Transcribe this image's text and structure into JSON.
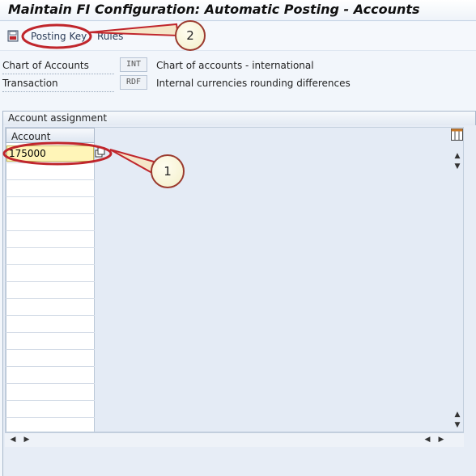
{
  "window": {
    "title": "Maintain FI Configuration: Automatic Posting - Accounts"
  },
  "toolbar": {
    "posting_key_label": "Posting Key",
    "rules_label": "Rules"
  },
  "header_fields": [
    {
      "label": "Chart of Accounts",
      "value": "INT",
      "description": "Chart of accounts - international"
    },
    {
      "label": "Transaction",
      "value": "RDF",
      "description": "Internal currencies rounding differences"
    }
  ],
  "account_assignment": {
    "group_title": "Account assignment",
    "column_header": "Account",
    "rows": [
      "175000"
    ]
  },
  "callouts": [
    {
      "number": "1"
    },
    {
      "number": "2"
    }
  ],
  "colors": {
    "highlight_ring": "#c0262c",
    "input_active": "#fff5b8",
    "panel_bg": "#e7edf6"
  }
}
